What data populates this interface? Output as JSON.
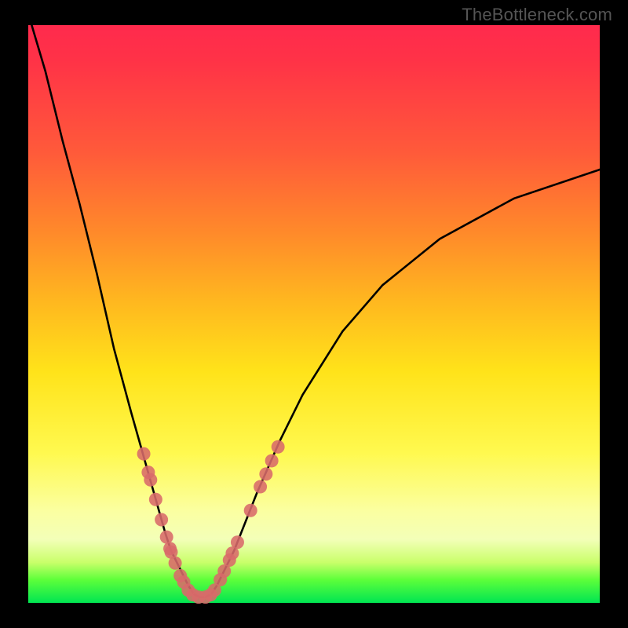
{
  "watermark": "TheBottleneck.com",
  "chart_data": {
    "type": "line",
    "title": "",
    "xlabel": "",
    "ylabel": "",
    "xlim": [
      0,
      100
    ],
    "ylim": [
      0,
      100
    ],
    "grid": false,
    "series": [
      {
        "name": "bottleneck-curve",
        "x": [
          0,
          3,
          6,
          9,
          12,
          15,
          18,
          20,
          22,
          24,
          25,
          27,
          28,
          29,
          30,
          31,
          32,
          33,
          34,
          36,
          38,
          40,
          44,
          48,
          55,
          62,
          72,
          85,
          100
        ],
        "y": [
          102,
          92,
          80,
          69,
          57,
          44,
          33,
          26,
          19,
          12,
          9,
          5,
          3,
          1.5,
          1,
          1,
          1.5,
          3,
          5,
          9,
          14,
          19,
          28,
          36,
          47,
          55,
          63,
          70,
          75
        ]
      }
    ],
    "markers": {
      "name": "sample-points",
      "color": "#d86a6a",
      "points": [
        {
          "x": 20.2,
          "y": 25.8
        },
        {
          "x": 21.0,
          "y": 22.6
        },
        {
          "x": 21.4,
          "y": 21.3
        },
        {
          "x": 22.3,
          "y": 17.9
        },
        {
          "x": 23.3,
          "y": 14.4
        },
        {
          "x": 24.2,
          "y": 11.4
        },
        {
          "x": 24.8,
          "y": 9.4
        },
        {
          "x": 25.0,
          "y": 8.8
        },
        {
          "x": 25.7,
          "y": 6.9
        },
        {
          "x": 26.6,
          "y": 4.7
        },
        {
          "x": 27.2,
          "y": 3.6
        },
        {
          "x": 28.0,
          "y": 2.2
        },
        {
          "x": 28.8,
          "y": 1.4
        },
        {
          "x": 29.8,
          "y": 1.0
        },
        {
          "x": 31.0,
          "y": 1.0
        },
        {
          "x": 31.9,
          "y": 1.4
        },
        {
          "x": 32.6,
          "y": 2.2
        },
        {
          "x": 33.6,
          "y": 4.0
        },
        {
          "x": 34.3,
          "y": 5.5
        },
        {
          "x": 35.2,
          "y": 7.4
        },
        {
          "x": 35.7,
          "y": 8.6
        },
        {
          "x": 36.6,
          "y": 10.5
        },
        {
          "x": 38.9,
          "y": 16.0
        },
        {
          "x": 40.6,
          "y": 20.1
        },
        {
          "x": 41.6,
          "y": 22.3
        },
        {
          "x": 42.6,
          "y": 24.6
        },
        {
          "x": 43.7,
          "y": 27.0
        }
      ]
    }
  }
}
